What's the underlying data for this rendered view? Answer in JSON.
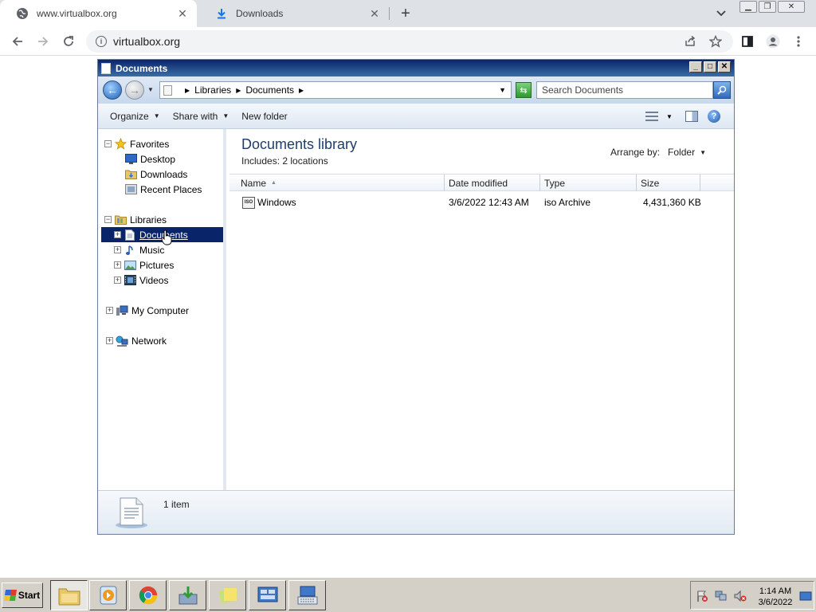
{
  "browser": {
    "tabs": [
      {
        "title": "www.virtualbox.org",
        "icon": "globe-icon",
        "active": true
      },
      {
        "title": "Downloads",
        "icon": "download-icon",
        "active": false
      }
    ],
    "address": "virtualbox.org"
  },
  "explorer": {
    "title": "Documents",
    "breadcrumb": [
      "Libraries",
      "Documents"
    ],
    "search_placeholder": "Search Documents",
    "commands": {
      "organize": "Organize",
      "share_with": "Share with",
      "new_folder": "New folder"
    },
    "nav": {
      "favorites": {
        "label": "Favorites",
        "items": [
          "Desktop",
          "Downloads",
          "Recent Places"
        ]
      },
      "libraries": {
        "label": "Libraries",
        "items": [
          "Documents",
          "Music",
          "Pictures",
          "Videos"
        ]
      },
      "computer": "My Computer",
      "network": "Network"
    },
    "library": {
      "title": "Documents library",
      "includes_label": "Includes:",
      "includes_link": "2 locations",
      "arrange_label": "Arrange by:",
      "arrange_value": "Folder"
    },
    "columns": [
      "Name",
      "Date modified",
      "Type",
      "Size"
    ],
    "files": [
      {
        "name": "Windows",
        "date": "3/6/2022 12:43 AM",
        "type": "iso Archive",
        "size": "4,431,360 KB",
        "icon_text": "ISO"
      }
    ],
    "status": "1 item"
  },
  "taskbar": {
    "start_label": "Start",
    "clock_time": "1:14 AM",
    "clock_date": "3/6/2022"
  },
  "colors": {
    "title_gradient": [
      "#0a246a",
      "#3a6ea5"
    ],
    "selection": "#0a246a",
    "library_title": "#1e3d6b"
  }
}
